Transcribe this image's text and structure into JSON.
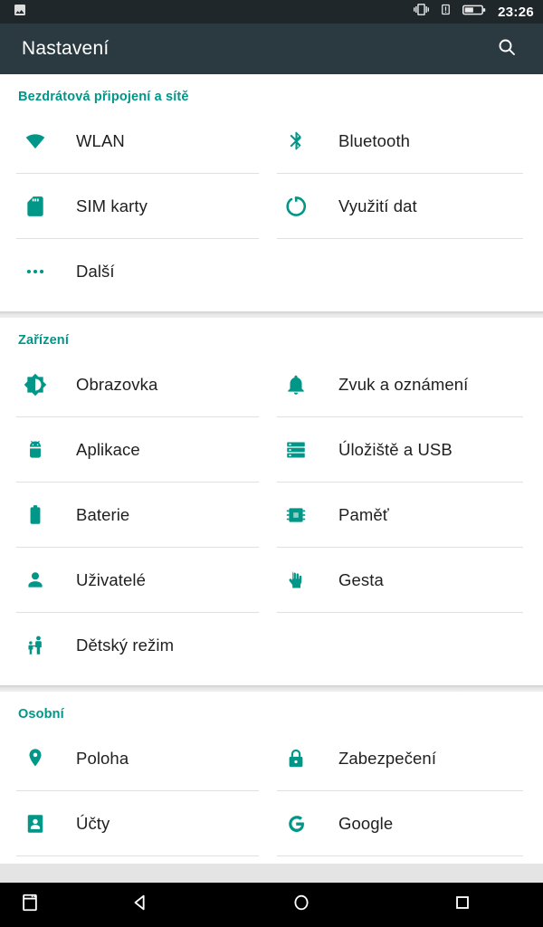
{
  "status_bar": {
    "time": "23:26",
    "left_icons": [
      {
        "name": "screenshot-image-icon"
      }
    ],
    "right_icons": [
      {
        "name": "vibrate-icon"
      },
      {
        "name": "sim-alert-icon"
      },
      {
        "name": "battery-icon"
      }
    ]
  },
  "app_bar": {
    "title": "Nastavení",
    "search_label": "search-icon"
  },
  "colors": {
    "accent": "#009688",
    "app_bar": "#2b3a41",
    "status_bar": "#1f272b",
    "card": "#ffffff",
    "divider": "#e0e0e0",
    "text_primary": "#1f1f1f",
    "nav_bar": "#000000"
  },
  "sections": [
    {
      "title": "Bezdrátová připojení a sítě",
      "items": [
        {
          "label": "WLAN",
          "icon": "wifi-icon"
        },
        {
          "label": "Bluetooth",
          "icon": "bluetooth-icon"
        },
        {
          "label": "SIM karty",
          "icon": "sim-card-icon"
        },
        {
          "label": "Využití dat",
          "icon": "data-usage-icon"
        },
        {
          "label": "Další",
          "icon": "more-dots-icon"
        },
        {
          "label": "",
          "icon": ""
        }
      ]
    },
    {
      "title": "Zařízení",
      "items": [
        {
          "label": "Obrazovka",
          "icon": "brightness-icon"
        },
        {
          "label": "Zvuk a oznámení",
          "icon": "bell-icon"
        },
        {
          "label": "Aplikace",
          "icon": "android-icon"
        },
        {
          "label": "Úložiště a USB",
          "icon": "storage-icon"
        },
        {
          "label": "Baterie",
          "icon": "battery-full-icon"
        },
        {
          "label": "Paměť",
          "icon": "memory-chip-icon"
        },
        {
          "label": "Uživatelé",
          "icon": "person-icon"
        },
        {
          "label": "Gesta",
          "icon": "hand-gesture-icon"
        },
        {
          "label": "Dětský režim",
          "icon": "child-mode-icon"
        },
        {
          "label": "",
          "icon": ""
        }
      ]
    },
    {
      "title": "Osobní",
      "items": [
        {
          "label": "Poloha",
          "icon": "location-pin-icon"
        },
        {
          "label": "Zabezpečení",
          "icon": "lock-icon"
        },
        {
          "label": "Účty",
          "icon": "accounts-icon"
        },
        {
          "label": "Google",
          "icon": "google-g-icon"
        }
      ]
    }
  ],
  "nav_bar": {
    "buttons": [
      {
        "name": "multi-window-button"
      },
      {
        "name": "back-button"
      },
      {
        "name": "home-button"
      },
      {
        "name": "recents-button"
      }
    ]
  }
}
